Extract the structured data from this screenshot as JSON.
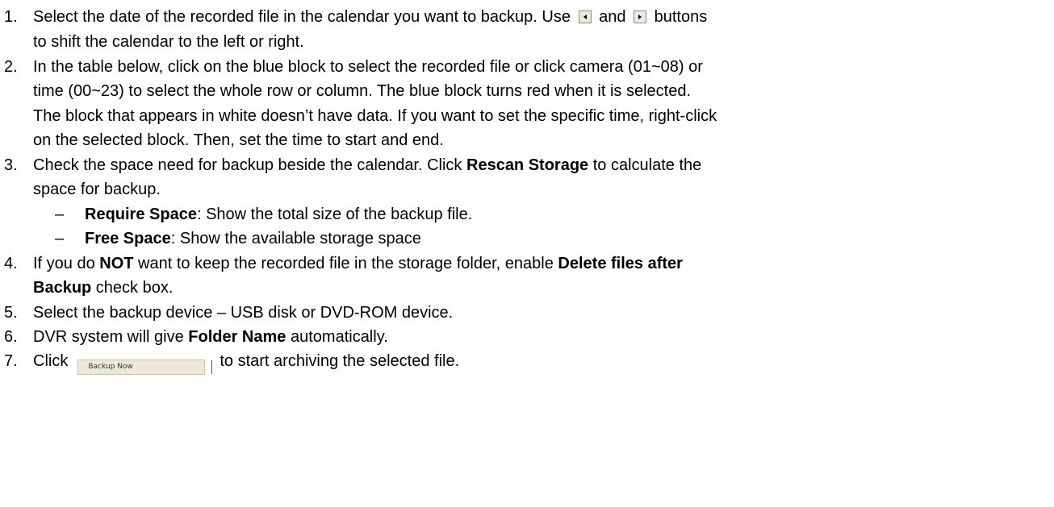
{
  "steps": [
    {
      "number": "1.",
      "lines": [
        [
          "Select the date of the recorded file in the calendar you want to backup. Use",
          "and",
          "buttons"
        ],
        [
          "to shift the calendar to the left or right."
        ]
      ],
      "left_button_icon": "left-arrow-icon",
      "right_button_icon": "right-arrow-icon"
    },
    {
      "number": "2.",
      "lines": [
        "In the table below, click on the blue block to select the recorded file or click camera (01~08) or",
        "time (00~23) to select the whole row or column. The blue block turns red when it is selected.",
        "The block that appears in white doesn’t have data. If you want to set the specific time, right-click",
        "on the selected block. Then, set the time to start and end."
      ]
    },
    {
      "number": "3.",
      "line1_before": "Check the space need for backup beside the calendar. Click ",
      "line1_bold": "Rescan Storage",
      "line1_after": " to calculate the",
      "line2": "space for backup.",
      "bullets": [
        {
          "dash": "–",
          "bold": "Require Space",
          "text": ": Show the total size of the backup file."
        },
        {
          "dash": "–",
          "bold": "Free Space",
          "text": ": Show the available storage space"
        }
      ]
    },
    {
      "number": "4.",
      "line1_before": "If you do ",
      "line1_bold1": "NOT",
      "line1_mid": " want to keep the recorded file in the storage folder, enable ",
      "line1_bold2": "Delete files after",
      "line2_bold": "Backup",
      "line2_after": " check box."
    },
    {
      "number": "5.",
      "text": "Select the backup device – USB disk or DVD-ROM device."
    },
    {
      "number": "6.",
      "before": "DVR system will give ",
      "bold": "Folder Name",
      "after": " automatically."
    },
    {
      "number": "7.",
      "before": "Click",
      "button_label": "Backup Now",
      "after": "to start archiving the selected file."
    }
  ]
}
